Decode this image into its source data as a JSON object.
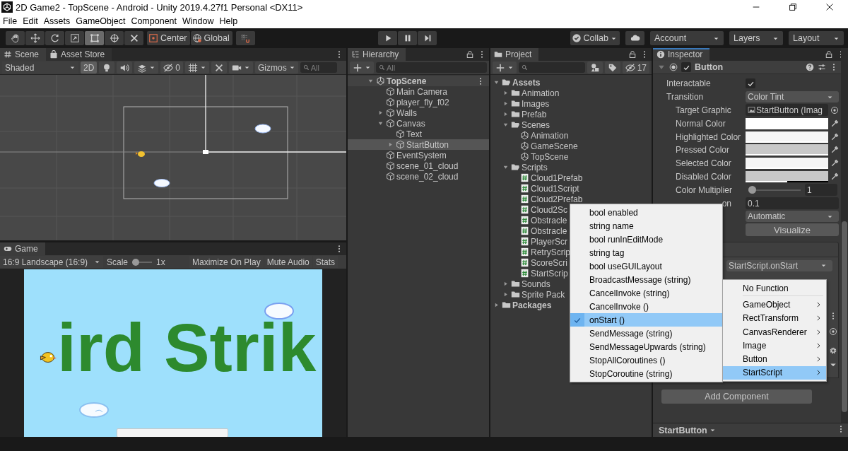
{
  "window": {
    "title": "2D Game2 - TopScene - Android - Unity 2019.4.27f1 Personal <DX11>"
  },
  "menu": [
    "File",
    "Edit",
    "Assets",
    "GameObject",
    "Component",
    "Window",
    "Help"
  ],
  "toolbar": {
    "tools": [
      {
        "selected": false
      },
      {
        "selected": false
      },
      {
        "selected": false
      },
      {
        "selected": false
      },
      {
        "selected": true
      },
      {
        "selected": false
      },
      {
        "selected": false
      }
    ],
    "pivot": "Center",
    "space": "Global",
    "collab": "Collab",
    "account": "Account",
    "layers": "Layers",
    "layout": "Layout"
  },
  "scene_panel": {
    "tabs": [
      {
        "label": "Scene",
        "selected": true
      },
      {
        "label": "Asset Store",
        "selected": false
      }
    ],
    "shading": "Shaded",
    "mode_2d": {
      "label": "2D",
      "on": true
    },
    "hidden_count": "0",
    "gizmos": "Gizmos",
    "search": {
      "placeholder": "All"
    }
  },
  "game_panel": {
    "tab": "Game",
    "aspect": "16:9 Landscape (16:9)",
    "scale_label": "Scale",
    "scale": {
      "level": 0
    },
    "scale_value": "1x",
    "buttons": [
      "Maximize On Play",
      "Mute Audio",
      "Stats"
    ],
    "title_text": "ird Strik"
  },
  "hierarchy": {
    "tab": "Hierarchy",
    "search": {
      "placeholder": "All"
    },
    "items": [
      {
        "name": "TopScene",
        "kind": "scene",
        "selected": false,
        "expanded": true,
        "children": [
          {
            "name": "Main Camera",
            "kind": "object",
            "selected": false
          },
          {
            "name": "player_fly_f02",
            "kind": "object",
            "selected": false
          },
          {
            "name": "Walls",
            "kind": "object",
            "selected": false,
            "expanded": false
          },
          {
            "name": "Canvas",
            "kind": "object",
            "selected": false,
            "expanded": true,
            "children": [
              {
                "name": "Text",
                "kind": "object",
                "selected": false
              },
              {
                "name": "StartButton",
                "kind": "object",
                "selected": true,
                "expanded": false
              }
            ]
          },
          {
            "name": "EventSystem",
            "kind": "object",
            "selected": false
          },
          {
            "name": "scene_01_cloud",
            "kind": "object",
            "selected": false
          },
          {
            "name": "scene_02_cloud",
            "kind": "object",
            "selected": false
          }
        ]
      }
    ]
  },
  "project": {
    "tab": "Project",
    "hidden_count": "17",
    "items": [
      {
        "name": "Assets",
        "kind": "folder",
        "expanded": true,
        "children": [
          {
            "name": "Animation",
            "kind": "folder",
            "expanded": false
          },
          {
            "name": "Images",
            "kind": "folder",
            "expanded": false
          },
          {
            "name": "Prefab",
            "kind": "folder",
            "expanded": false
          },
          {
            "name": "Scenes",
            "kind": "folder",
            "expanded": true,
            "children": [
              {
                "name": "Animation",
                "kind": "scene"
              },
              {
                "name": "GameScene",
                "kind": "scene"
              },
              {
                "name": "TopScene",
                "kind": "scene"
              }
            ]
          },
          {
            "name": "Scripts",
            "kind": "folder",
            "expanded": true,
            "children": [
              {
                "name": "Cloud1Prefab",
                "kind": "script"
              },
              {
                "name": "Cloud1Script",
                "kind": "script"
              },
              {
                "name": "Cloud2Prefab",
                "kind": "script"
              },
              {
                "name": "Cloud2Sc",
                "kind": "script"
              },
              {
                "name": "Obstracle",
                "kind": "script"
              },
              {
                "name": "Obstracle",
                "kind": "script"
              },
              {
                "name": "PlayerScr",
                "kind": "script"
              },
              {
                "name": "RetryScrip",
                "kind": "script"
              },
              {
                "name": "ScoreScri",
                "kind": "script"
              },
              {
                "name": "StartScrip",
                "kind": "script"
              }
            ]
          },
          {
            "name": "Sounds",
            "kind": "folder",
            "expanded": false
          },
          {
            "name": "Sprite Pack",
            "kind": "folder",
            "expanded": false
          }
        ]
      },
      {
        "name": "Packages",
        "kind": "folder",
        "expanded": false
      }
    ]
  },
  "inspector": {
    "tab": "Inspector",
    "component": {
      "name": "Button",
      "enabled": true,
      "expanded": true
    },
    "rows": [
      {
        "kind": "checkbox",
        "label": "Interactable",
        "checked": true
      },
      {
        "kind": "dropdown",
        "label": "Transition",
        "value": "Color Tint",
        "children": [
          {
            "kind": "object",
            "label": "Target Graphic",
            "value": "StartButton (Imag"
          },
          {
            "kind": "color",
            "label": "Normal Color",
            "color": "#ffffff",
            "level": 1
          },
          {
            "kind": "color",
            "label": "Highlighted Color",
            "color": "#f5f5f5",
            "level": 1
          },
          {
            "kind": "color",
            "label": "Pressed Color",
            "color": "#c8c8c8",
            "level": 1
          },
          {
            "kind": "color",
            "label": "Selected Color",
            "color": "#f5f5f5",
            "level": 1
          },
          {
            "kind": "color",
            "label": "Disabled Color",
            "color": "#c8c8c8",
            "level": 0.5
          },
          {
            "kind": "slider",
            "label": "Color Multiplier",
            "level": 0,
            "value": "1"
          },
          {
            "kind": "number",
            "label": "on",
            "value": "0.1"
          }
        ]
      },
      {
        "kind": "dropdown",
        "value": "Automatic"
      },
      {
        "kind": "button",
        "value": "Visualize"
      }
    ],
    "on_click_function": "StartScript.onStart",
    "add_component": "Add Component",
    "footer": "StartButton"
  },
  "method_menu": {
    "items": [
      {
        "label": "bool enabled",
        "selected": false
      },
      {
        "label": "string name",
        "selected": false
      },
      {
        "label": "bool runInEditMode",
        "selected": false
      },
      {
        "label": "string tag",
        "selected": false
      },
      {
        "label": "bool useGUILayout",
        "selected": false
      },
      {
        "label": "BroadcastMessage (string)",
        "selected": false
      },
      {
        "label": "CancelInvoke (string)",
        "selected": false
      },
      {
        "label": "CancelInvoke ()",
        "selected": false
      },
      {
        "label": "onStart ()",
        "selected": true
      },
      {
        "label": "SendMessage (string)",
        "selected": false
      },
      {
        "label": "SendMessageUpwards (string)",
        "selected": false
      },
      {
        "label": "StopAllCoroutines ()",
        "selected": false
      },
      {
        "label": "StopCoroutine (string)",
        "selected": false
      }
    ]
  },
  "component_menu": {
    "items": [
      {
        "label": "No Function",
        "kind": "plain",
        "selected": false
      },
      {
        "label": "GameObject",
        "kind": "submenu",
        "selected": false
      },
      {
        "label": "RectTransform",
        "kind": "submenu",
        "selected": false
      },
      {
        "label": "CanvasRenderer",
        "kind": "submenu",
        "selected": false
      },
      {
        "label": "Image",
        "kind": "submenu",
        "selected": false
      },
      {
        "label": "Button",
        "kind": "submenu",
        "selected": false
      },
      {
        "label": "StartScript",
        "kind": "submenu",
        "selected": true
      }
    ]
  }
}
